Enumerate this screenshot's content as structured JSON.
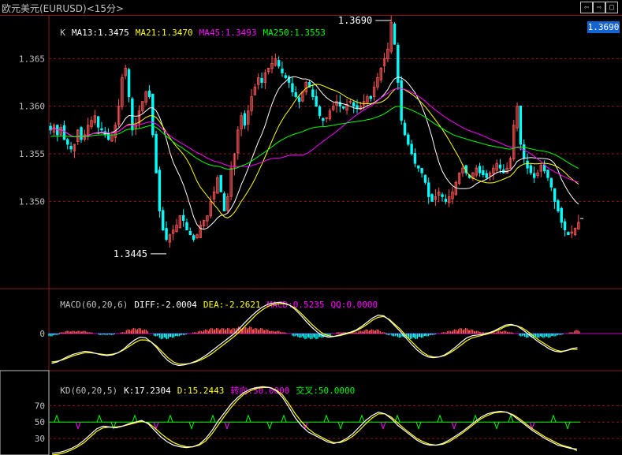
{
  "header": {
    "title": "欧元美元(EURUSD)<15分>",
    "nav_left": "⇦",
    "nav_right": "⇨",
    "nav_close": "▢"
  },
  "main_legend": [
    {
      "label": "K",
      "color": "#c0c0c0"
    },
    {
      "label": "MA13:1.3475",
      "color": "#ffffff"
    },
    {
      "label": "MA21:1.3470",
      "color": "#ffff00"
    },
    {
      "label": "MA45:1.3493",
      "color": "#ff00ff"
    },
    {
      "label": "MA250:1.3553",
      "color": "#00ff00"
    }
  ],
  "current_price": "1.3690",
  "macd_legend": [
    {
      "label": "MACD(60,20,6)",
      "color": "#c0c0c0"
    },
    {
      "label": "DIFF:-2.0004",
      "color": "#ffffff"
    },
    {
      "label": "DEA:-2.2621",
      "color": "#ffff00"
    },
    {
      "label": "MACD:0.5235",
      "color": "#ff00ff"
    },
    {
      "label": "QQ:0.0000",
      "color": "#ff00ff"
    }
  ],
  "kd_legend": [
    {
      "label": "KD(60,20,5)",
      "color": "#c0c0c0"
    },
    {
      "label": "K:17.2304",
      "color": "#ffffff"
    },
    {
      "label": "D:15.2443",
      "color": "#ffff00"
    },
    {
      "label": "转向:50.0000",
      "color": "#ff00ff"
    },
    {
      "label": "交叉:50.0000",
      "color": "#00ff00"
    }
  ],
  "colors": {
    "up": "#ff5555",
    "down": "#00ffff",
    "grid": "#8a1a1a",
    "axis_text": "#c0c0c0"
  },
  "chart_data": [
    {
      "type": "candlestick",
      "title": "",
      "y_ticks": [
        "1.365",
        "1.360",
        "1.355",
        "1.350"
      ],
      "ylim": [
        1.342,
        1.3695
      ],
      "annotations": [
        {
          "text": "1.3690",
          "value": 1.369
        },
        {
          "text": "1.3445",
          "value": 1.3445
        }
      ],
      "close": [
        1.3575,
        1.358,
        1.357,
        1.3578,
        1.3565,
        1.356,
        1.3555,
        1.356,
        1.3575,
        1.3565,
        1.357,
        1.358,
        1.3585,
        1.359,
        1.3578,
        1.3575,
        1.357,
        1.3565,
        1.357,
        1.358,
        1.36,
        1.363,
        1.364,
        1.361,
        1.3575,
        1.358,
        1.3595,
        1.3605,
        1.3615,
        1.361,
        1.357,
        1.353,
        1.349,
        1.347,
        1.346,
        1.3465,
        1.347,
        1.3475,
        1.3485,
        1.348,
        1.347,
        1.3465,
        1.346,
        1.3465,
        1.3475,
        1.348,
        1.3485,
        1.35,
        1.351,
        1.3525,
        1.351,
        1.349,
        1.3505,
        1.3535,
        1.355,
        1.3575,
        1.359,
        1.358,
        1.3595,
        1.361,
        1.362,
        1.363,
        1.3625,
        1.3635,
        1.364,
        1.3645,
        1.365,
        1.3642,
        1.3635,
        1.363,
        1.3625,
        1.3615,
        1.361,
        1.3605,
        1.3615,
        1.3625,
        1.362,
        1.361,
        1.36,
        1.359,
        1.3585,
        1.3588,
        1.3595,
        1.36,
        1.3605,
        1.36,
        1.3598,
        1.3602,
        1.3605,
        1.36,
        1.3598,
        1.36,
        1.3605,
        1.361,
        1.3608,
        1.362,
        1.363,
        1.364,
        1.365,
        1.366,
        1.3688,
        1.3665,
        1.3625,
        1.3585,
        1.357,
        1.356,
        1.355,
        1.354,
        1.3535,
        1.353,
        1.352,
        1.3505,
        1.35,
        1.3505,
        1.351,
        1.3505,
        1.35,
        1.3505,
        1.351,
        1.352,
        1.353,
        1.3535,
        1.353,
        1.3525,
        1.353,
        1.3535,
        1.353,
        1.3528,
        1.3525,
        1.353,
        1.3535,
        1.354,
        1.3535,
        1.353,
        1.3535,
        1.3545,
        1.358,
        1.36,
        1.356,
        1.3545,
        1.3535,
        1.353,
        1.3525,
        1.353,
        1.3538,
        1.3532,
        1.3525,
        1.3515,
        1.35,
        1.349,
        1.3478,
        1.347,
        1.3465,
        1.3468,
        1.3472,
        1.3478
      ],
      "ma13": [],
      "ma21": [],
      "ma45": [],
      "ma250": []
    },
    {
      "type": "bar+line",
      "title": "MACD",
      "y_ticks": [
        "0"
      ],
      "diff": [
        -4.2,
        -4.0,
        -3.6,
        -3.2,
        -2.9,
        -2.7,
        -2.5,
        -2.6,
        -2.8,
        -3.0,
        -3.1,
        -3.0,
        -2.7,
        -2.2,
        -1.5,
        -0.9,
        -0.5,
        -0.6,
        -1.2,
        -2.0,
        -3.0,
        -3.8,
        -4.3,
        -4.5,
        -4.4,
        -4.2,
        -3.9,
        -3.5,
        -3.0,
        -2.4,
        -1.8,
        -1.2,
        -0.6,
        0.0,
        0.8,
        1.6,
        2.4,
        3.1,
        3.7,
        4.1,
        4.3,
        4.4,
        4.3,
        4.0,
        3.4,
        2.6,
        1.7,
        0.9,
        0.2,
        -0.3,
        -0.5,
        -0.4,
        -0.2,
        0.0,
        0.2,
        0.5,
        1.0,
        1.6,
        2.2,
        2.6,
        2.5,
        1.9,
        1.1,
        0.3,
        -0.6,
        -1.5,
        -2.3,
        -2.9,
        -3.3,
        -3.4,
        -3.3,
        -3.0,
        -2.5,
        -1.9,
        -1.2,
        -0.6,
        -0.3,
        -0.2,
        -0.1,
        0.1,
        0.4,
        0.8,
        1.2,
        1.3,
        1.1,
        0.6,
        0.0,
        -0.6,
        -1.2,
        -1.7,
        -2.2,
        -2.5,
        -2.6,
        -2.4,
        -2.1,
        -2.0
      ],
      "dea": [
        -4.0,
        -3.9,
        -3.7,
        -3.4,
        -3.1,
        -2.9,
        -2.7,
        -2.7,
        -2.8,
        -2.9,
        -3.0,
        -2.9,
        -2.7,
        -2.3,
        -1.8,
        -1.3,
        -0.9,
        -0.9,
        -1.2,
        -1.8,
        -2.6,
        -3.4,
        -4.0,
        -4.3,
        -4.3,
        -4.2,
        -4.0,
        -3.7,
        -3.3,
        -2.8,
        -2.2,
        -1.6,
        -1.0,
        -0.4,
        0.3,
        1.1,
        1.9,
        2.7,
        3.3,
        3.8,
        4.1,
        4.2,
        4.2,
        4.0,
        3.6,
        2.9,
        2.1,
        1.3,
        0.6,
        0.0,
        -0.3,
        -0.4,
        -0.3,
        -0.1,
        0.1,
        0.4,
        0.8,
        1.3,
        1.9,
        2.3,
        2.4,
        2.0,
        1.3,
        0.6,
        -0.3,
        -1.1,
        -1.9,
        -2.6,
        -3.1,
        -3.3,
        -3.3,
        -3.1,
        -2.7,
        -2.2,
        -1.6,
        -1.0,
        -0.6,
        -0.4,
        -0.2,
        0.0,
        0.3,
        0.6,
        1.0,
        1.2,
        1.1,
        0.8,
        0.3,
        -0.3,
        -0.9,
        -1.4,
        -1.9,
        -2.3,
        -2.5,
        -2.4,
        -2.2,
        -2.26
      ]
    },
    {
      "type": "line",
      "title": "KD",
      "y_ticks": [
        "70",
        "50",
        "30"
      ],
      "ylim": [
        10,
        100
      ],
      "k": [
        12,
        13,
        15,
        18,
        22,
        28,
        35,
        42,
        45,
        44,
        43,
        45,
        48,
        50,
        52,
        48,
        40,
        32,
        26,
        22,
        20,
        19,
        20,
        23,
        30,
        40,
        52,
        62,
        72,
        80,
        86,
        90,
        92,
        93,
        92,
        88,
        80,
        68,
        55,
        45,
        38,
        34,
        30,
        26,
        24,
        26,
        30,
        36,
        44,
        52,
        58,
        62,
        60,
        54,
        46,
        40,
        34,
        28,
        24,
        22,
        22,
        24,
        28,
        33,
        38,
        44,
        50,
        56,
        60,
        62,
        63,
        62,
        58,
        52,
        46,
        40,
        35,
        30,
        26,
        22,
        20,
        18,
        17.2
      ],
      "d": [
        10,
        11,
        13,
        16,
        20,
        25,
        32,
        39,
        43,
        44,
        44,
        45,
        47,
        49,
        51,
        49,
        43,
        36,
        30,
        25,
        22,
        20,
        20,
        22,
        27,
        36,
        47,
        58,
        68,
        77,
        84,
        88,
        91,
        92,
        92,
        89,
        83,
        72,
        60,
        50,
        42,
        36,
        32,
        28,
        25,
        25,
        28,
        33,
        40,
        48,
        55,
        60,
        60,
        56,
        49,
        42,
        36,
        30,
        26,
        23,
        22,
        23,
        26,
        31,
        36,
        42,
        48,
        54,
        58,
        61,
        62,
        62,
        59,
        54,
        48,
        42,
        37,
        32,
        28,
        24,
        21,
        19,
        15.2
      ]
    }
  ]
}
